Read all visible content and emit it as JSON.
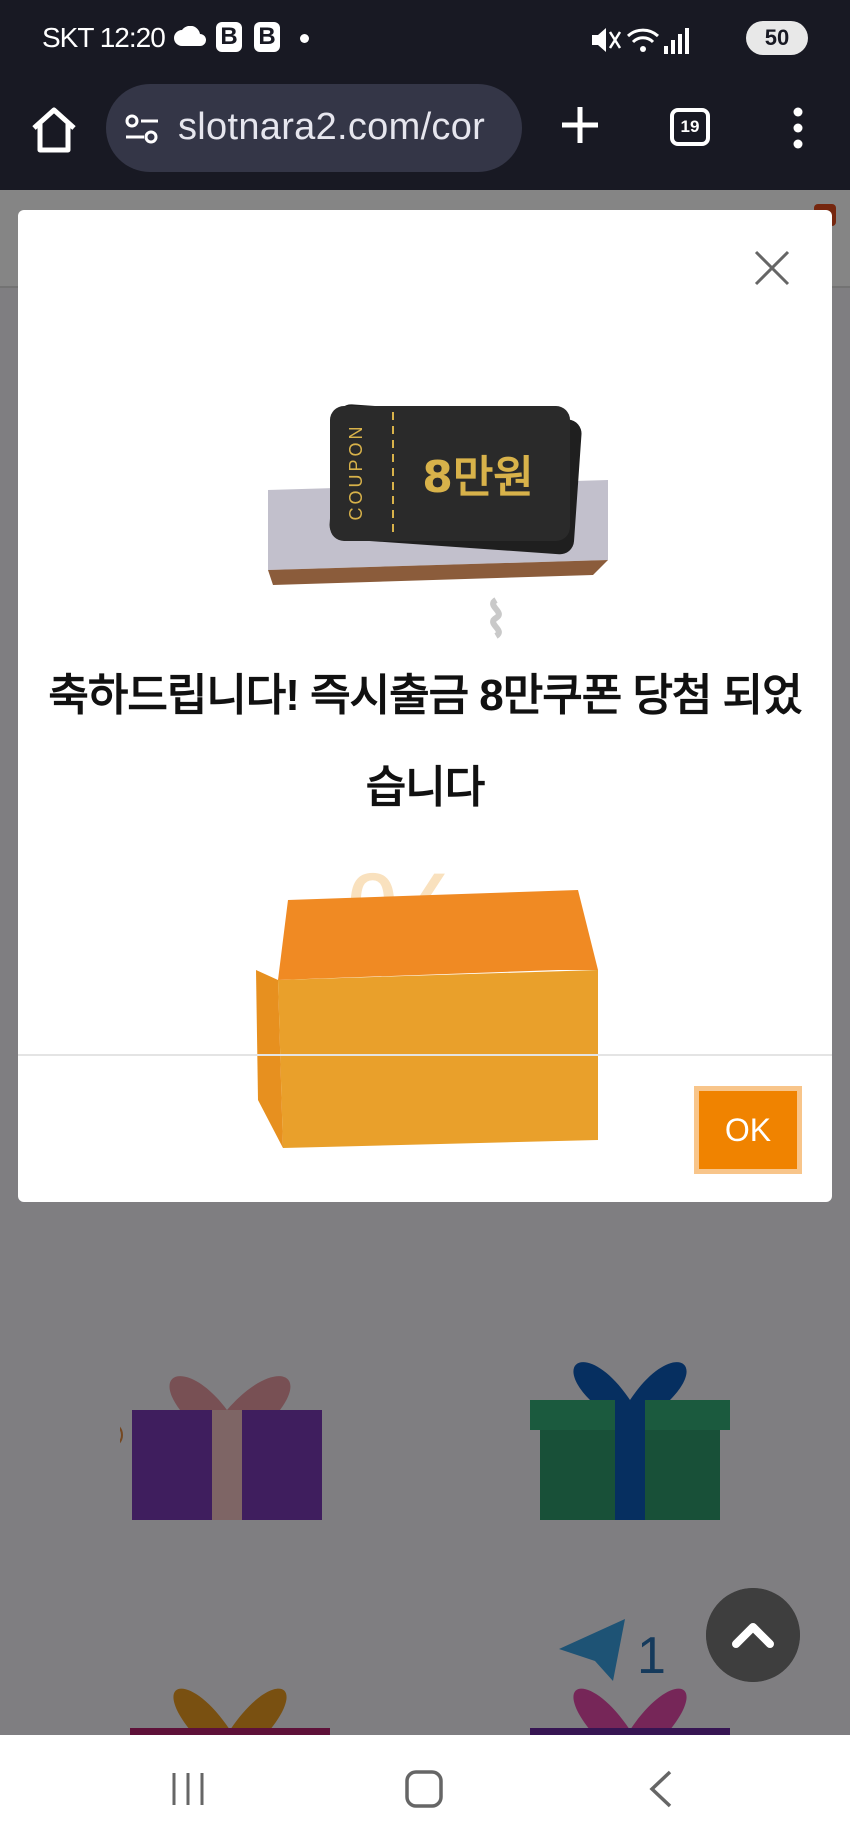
{
  "status_bar": {
    "carrier_time": "SKT 12:20",
    "battery_level": "50",
    "icons": [
      "cloud-icon",
      "blog-b-icon",
      "blog-b-icon",
      "dot-icon",
      "mute-icon",
      "wifi-icon",
      "signal-icon",
      "battery-icon"
    ]
  },
  "browser": {
    "url": "slotnara2.com/cor",
    "tab_count": "19",
    "icons": [
      "home-icon",
      "site-settings-icon",
      "new-tab-plus-icon",
      "tab-switcher-icon",
      "more-menu-icon"
    ]
  },
  "dialog": {
    "coupon_stub_label": "COUPON",
    "coupon_amount": "8만원",
    "message": "축하드립니다! 즉시출금 8만쿠폰 당첨 되었습니다",
    "ok_label": "OK"
  },
  "page_background": {
    "badge_count": "1"
  },
  "colors": {
    "chrome_bg": "#181923",
    "url_bar_bg": "#343647",
    "ok_button": "#f08300",
    "ok_button_border": "#f8c58a",
    "coupon_gold": "#d8b24a",
    "box_orange": "#e9a02b"
  }
}
